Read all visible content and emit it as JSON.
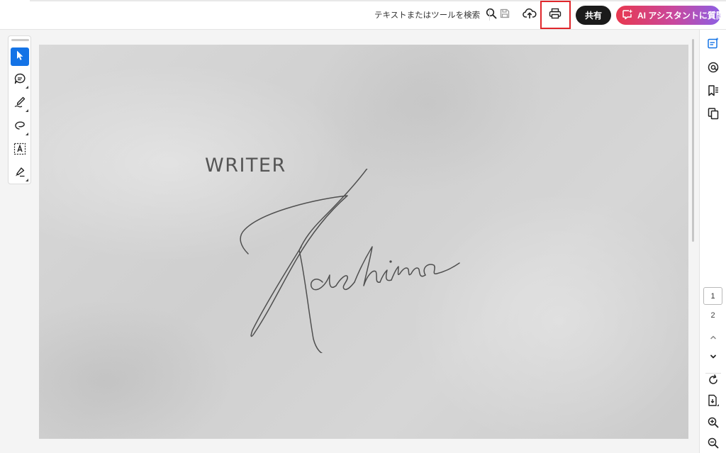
{
  "toolbar": {
    "search_label": "テキストまたはツールを検索",
    "share_label": "共有",
    "ai_assistant_label": "AI アシスタントに質問",
    "print_highlight_color": "#e0262b"
  },
  "document": {
    "heading": "WRITER",
    "signature_text": "Kashima"
  },
  "pagination": {
    "current_page": "1",
    "total_pages": "2"
  },
  "colors": {
    "accent": "#1473e6",
    "share_button": "#1b1b1b",
    "ai_gradient_start": "#e8384f",
    "ai_gradient_end": "#8d5fe4"
  }
}
